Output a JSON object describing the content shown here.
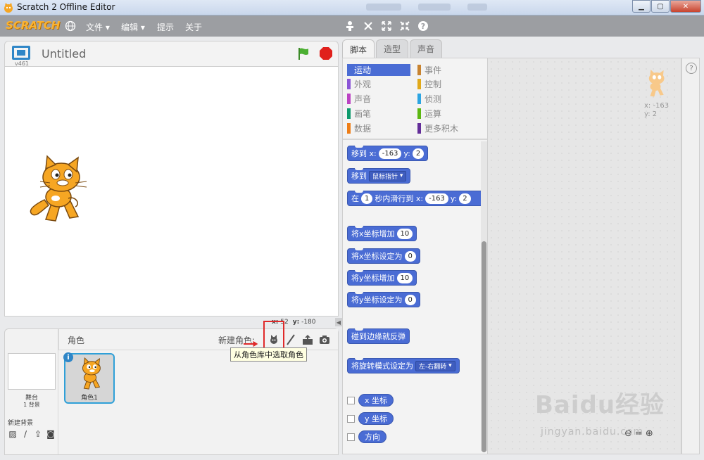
{
  "window": {
    "title": "Scratch 2 Offline Editor",
    "controls": [
      "minimize",
      "maximize",
      "close"
    ]
  },
  "menubar": {
    "logo": "SCRATCH",
    "items": [
      {
        "label": "文件 ▾"
      },
      {
        "label": "编辑 ▾"
      },
      {
        "label": "提示"
      },
      {
        "label": "关于"
      }
    ],
    "tool_icons": [
      "duplicate-icon",
      "delete-icon",
      "grow-icon",
      "shrink-icon",
      "help-icon"
    ]
  },
  "stage": {
    "version": "v461",
    "project_title": "Untitled",
    "mouse_x_label": "x:",
    "mouse_x": "52",
    "mouse_y_label": "y:",
    "mouse_y": "-180"
  },
  "sprites_panel": {
    "label": "角色",
    "new_sprite_label": "新建角色:",
    "tooltip": "从角色库中选取角色",
    "stage_name": "舞台",
    "stage_backdrops": "1 背景",
    "new_backdrop_label": "新建背景",
    "sprite_name": "角色1"
  },
  "tabs": [
    {
      "label": "脚本",
      "active": true
    },
    {
      "label": "造型",
      "active": false
    },
    {
      "label": "声音",
      "active": false
    }
  ],
  "categories": [
    {
      "label": "运动",
      "color": "#4a6cd4",
      "active": true
    },
    {
      "label": "事件",
      "color": "#c88330"
    },
    {
      "label": "外观",
      "color": "#8a55d7"
    },
    {
      "label": "控制",
      "color": "#e1a91a"
    },
    {
      "label": "声音",
      "color": "#bb42c3"
    },
    {
      "label": "侦测",
      "color": "#2ca5e2"
    },
    {
      "label": "画笔",
      "color": "#0e9a6c"
    },
    {
      "label": "运算",
      "color": "#5cb712"
    },
    {
      "label": "数据",
      "color": "#ee7d16"
    },
    {
      "label": "更多积木",
      "color": "#632d99"
    }
  ],
  "blocks": {
    "goto_xy": {
      "a": "移到 x:",
      "x": "-163",
      "b": "y:",
      "y": "2"
    },
    "goto": {
      "a": "移到",
      "target": "鼠标指针"
    },
    "glide": {
      "a": "在",
      "secs": "1",
      "b": "秒内滑行到 x:",
      "x": "-163",
      "c": "y:",
      "y": "2"
    },
    "change_x": {
      "label": "将x坐标增加",
      "value": "10"
    },
    "set_x": {
      "label": "将x坐标设定为",
      "value": "0"
    },
    "change_y": {
      "label": "将y坐标增加",
      "value": "10"
    },
    "set_y": {
      "label": "将y坐标设定为",
      "value": "0"
    },
    "bounce": {
      "label": "碰到边缘就反弹"
    },
    "rotation_style": {
      "label": "将旋转模式设定为",
      "value": "左-右翻转"
    },
    "reporters": [
      {
        "label": "x 坐标"
      },
      {
        "label": "y 坐标"
      },
      {
        "label": "方向"
      }
    ]
  },
  "script_area": {
    "sprite_x": "x: -163",
    "sprite_y": "y: 2"
  },
  "watermark": {
    "brand": "Baidu经验",
    "url": "jingyan.baidu.com"
  },
  "colors": {
    "motion_blue": "#4a6cd4",
    "menubar_gray": "#9c9ea2",
    "highlight_red": "#e02a2a"
  }
}
